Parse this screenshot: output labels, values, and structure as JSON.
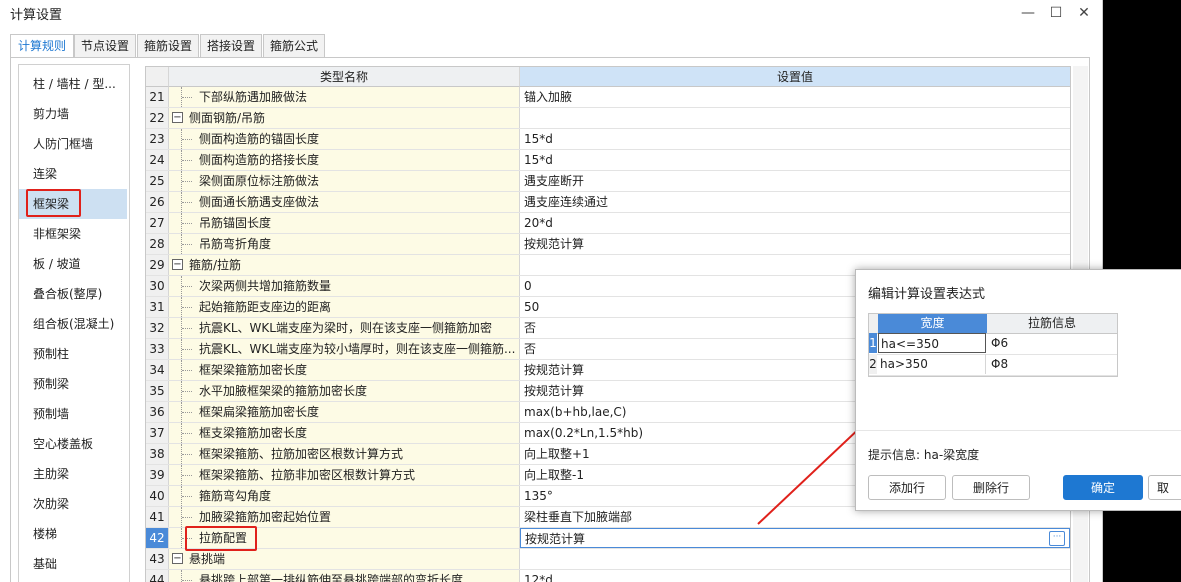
{
  "window": {
    "title": "计算设置",
    "minimize": "—",
    "maximize": "☐",
    "close": "✕"
  },
  "tabs": [
    {
      "label": "计算规则",
      "active": true
    },
    {
      "label": "节点设置"
    },
    {
      "label": "箍筋设置"
    },
    {
      "label": "搭接设置"
    },
    {
      "label": "箍筋公式"
    }
  ],
  "sidebar": {
    "items": [
      {
        "label": "柱 / 墙柱 / 型..."
      },
      {
        "label": "剪力墙"
      },
      {
        "label": "人防门框墙"
      },
      {
        "label": "连梁"
      },
      {
        "label": "框架梁",
        "selected": true
      },
      {
        "label": "非框架梁"
      },
      {
        "label": "板 / 坡道"
      },
      {
        "label": "叠合板(整厚)"
      },
      {
        "label": "组合板(混凝土)"
      },
      {
        "label": "预制柱"
      },
      {
        "label": "预制梁"
      },
      {
        "label": "预制墙"
      },
      {
        "label": "空心楼盖板"
      },
      {
        "label": "主肋梁"
      },
      {
        "label": "次肋梁"
      },
      {
        "label": "楼梯"
      },
      {
        "label": "基础"
      }
    ]
  },
  "grid": {
    "headers": {
      "name": "类型名称",
      "value": "设置值"
    },
    "rows": [
      {
        "num": "21",
        "name": "下部纵筋遇加腋做法",
        "value": "锚入加腋"
      },
      {
        "num": "22",
        "name": "侧面钢筋/吊筋",
        "value": "",
        "group": true
      },
      {
        "num": "23",
        "name": "侧面构造筋的锚固长度",
        "value": "15*d"
      },
      {
        "num": "24",
        "name": "侧面构造筋的搭接长度",
        "value": "15*d"
      },
      {
        "num": "25",
        "name": "梁侧面原位标注筋做法",
        "value": "遇支座断开"
      },
      {
        "num": "26",
        "name": "侧面通长筋遇支座做法",
        "value": "遇支座连续通过"
      },
      {
        "num": "27",
        "name": "吊筋锚固长度",
        "value": "20*d"
      },
      {
        "num": "28",
        "name": "吊筋弯折角度",
        "value": "按规范计算"
      },
      {
        "num": "29",
        "name": "箍筋/拉筋",
        "value": "",
        "group": true
      },
      {
        "num": "30",
        "name": "次梁两侧共增加箍筋数量",
        "value": "0"
      },
      {
        "num": "31",
        "name": "起始箍筋距支座边的距离",
        "value": "50"
      },
      {
        "num": "32",
        "name": "抗震KL、WKL端支座为梁时，则在该支座一侧箍筋加密",
        "value": "否"
      },
      {
        "num": "33",
        "name": "抗震KL、WKL端支座为较小墙厚时，则在该支座一侧箍筋...",
        "value": "否"
      },
      {
        "num": "34",
        "name": "框架梁箍筋加密长度",
        "value": "按规范计算"
      },
      {
        "num": "35",
        "name": "水平加腋框架梁的箍筋加密长度",
        "value": "按规范计算"
      },
      {
        "num": "36",
        "name": "框架扁梁箍筋加密长度",
        "value": "max(b+hb,lae,C)"
      },
      {
        "num": "37",
        "name": "框支梁箍筋加密长度",
        "value": "max(0.2*Ln,1.5*hb)"
      },
      {
        "num": "38",
        "name": "框架梁箍筋、拉筋加密区根数计算方式",
        "value": "向上取整+1"
      },
      {
        "num": "39",
        "name": "框架梁箍筋、拉筋非加密区根数计算方式",
        "value": "向上取整-1"
      },
      {
        "num": "40",
        "name": "箍筋弯勾角度",
        "value": "135°"
      },
      {
        "num": "41",
        "name": "加腋梁箍筋加密起始位置",
        "value": "梁柱垂直下加腋端部"
      },
      {
        "num": "42",
        "name": "拉筋配置",
        "value": "按规范计算",
        "current": true
      },
      {
        "num": "43",
        "name": "悬挑端",
        "value": "",
        "group": true
      },
      {
        "num": "44",
        "name": "悬挑跨上部第一排纵筋伸至悬挑跨端部的弯折长度",
        "value": "12*d"
      }
    ]
  },
  "dialog": {
    "title": "编辑计算设置表达式",
    "headers": {
      "width": "宽度",
      "tie": "拉筋信息"
    },
    "rows": [
      {
        "num": "1",
        "width": "ha<=350",
        "tie": "Φ6",
        "current": true
      },
      {
        "num": "2",
        "width": "ha>350",
        "tie": "Φ8"
      }
    ],
    "hint": "提示信息: ha-梁宽度",
    "buttons": {
      "add": "添加行",
      "delete": "删除行",
      "ok": "确定",
      "cancel": "取"
    }
  },
  "colors": {
    "accent": "#1e78d2",
    "highlight": "#e0211b",
    "name_cell_bg": "#fdfbe5"
  }
}
